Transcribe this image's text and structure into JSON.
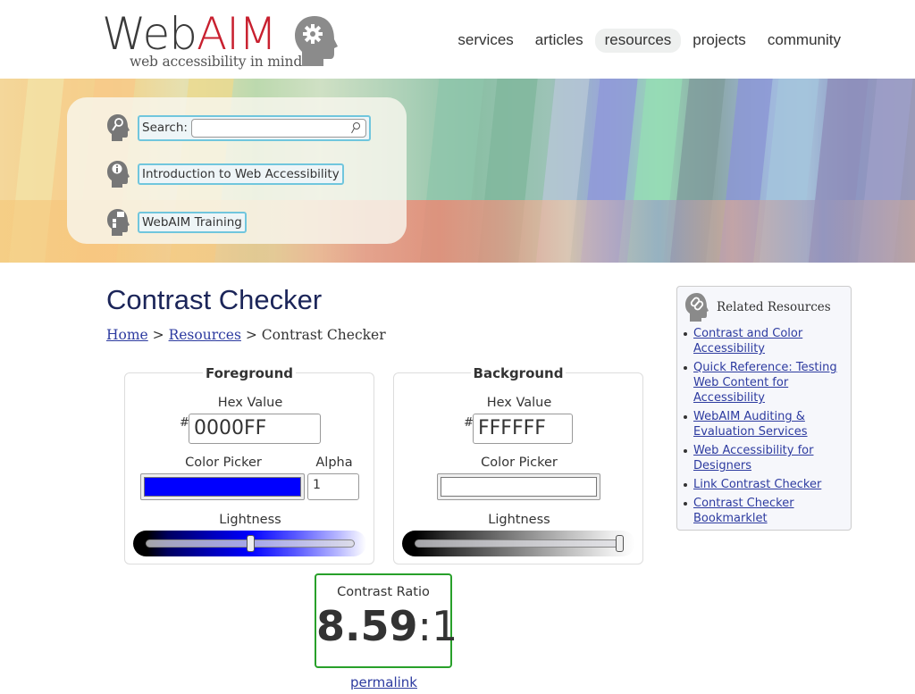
{
  "logo": {
    "word_part1": "Web",
    "word_part2": "AIM",
    "tagline": "web accessibility in mind",
    "accent_color": "#c8202f"
  },
  "nav": {
    "items": [
      {
        "label": "services",
        "active": false
      },
      {
        "label": "articles",
        "active": false
      },
      {
        "label": "resources",
        "active": true
      },
      {
        "label": "projects",
        "active": false
      },
      {
        "label": "community",
        "active": false
      }
    ]
  },
  "quick_links": {
    "search_label": "Search:",
    "search_value": "",
    "intro_label": "Introduction to Web Accessibility",
    "training_label": "WebAIM Training",
    "icons": [
      "search-head-icon",
      "info-head-icon",
      "training-head-icon"
    ]
  },
  "page": {
    "title": "Contrast Checker",
    "breadcrumb": {
      "home": "Home",
      "sep1": " > ",
      "resources": "Resources",
      "sep2": " > ",
      "current": "Contrast Checker"
    }
  },
  "foreground": {
    "legend": "Foreground",
    "hex_label": "Hex Value",
    "hash": "#",
    "hex_value": "0000FF",
    "picker_label": "Color Picker",
    "picker_color": "#0000ff",
    "alpha_label": "Alpha",
    "alpha_value": "1",
    "lightness_label": "Lightness",
    "lightness_percent": 50
  },
  "background": {
    "legend": "Background",
    "hex_label": "Hex Value",
    "hash": "#",
    "hex_value": "FFFFFF",
    "picker_label": "Color Picker",
    "picker_color": "#ffffff",
    "lightness_label": "Lightness",
    "lightness_percent": 100
  },
  "result": {
    "label": "Contrast Ratio",
    "ratio_main": "8.59",
    "ratio_rest": ":1",
    "pass_color": "#28a02a",
    "permalink": "permalink"
  },
  "related": {
    "title": "Related Resources",
    "links": [
      "Contrast and Color Accessibility",
      "Quick Reference: Testing Web Content for Accessibility",
      "WebAIM Auditing & Evaluation Services",
      "Web Accessibility for Designers",
      "Link Contrast Checker",
      "Contrast Checker Bookmarklet"
    ]
  }
}
